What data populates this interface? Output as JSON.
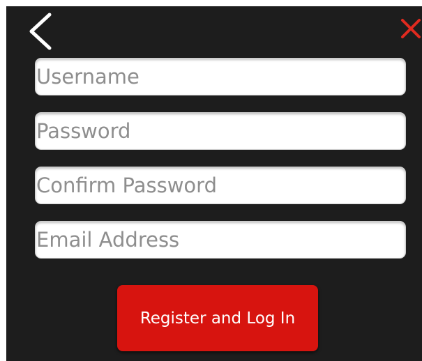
{
  "header": {
    "back_icon": "chevron-left-icon",
    "close_icon": "close-x-icon",
    "close_color": "#e02a1f"
  },
  "form": {
    "username_placeholder": "Username",
    "password_placeholder": "Password",
    "confirm_password_placeholder": "Confirm Password",
    "email_placeholder": "Email Address"
  },
  "actions": {
    "register_label": "Register and Log In",
    "register_color": "#d7140f"
  }
}
